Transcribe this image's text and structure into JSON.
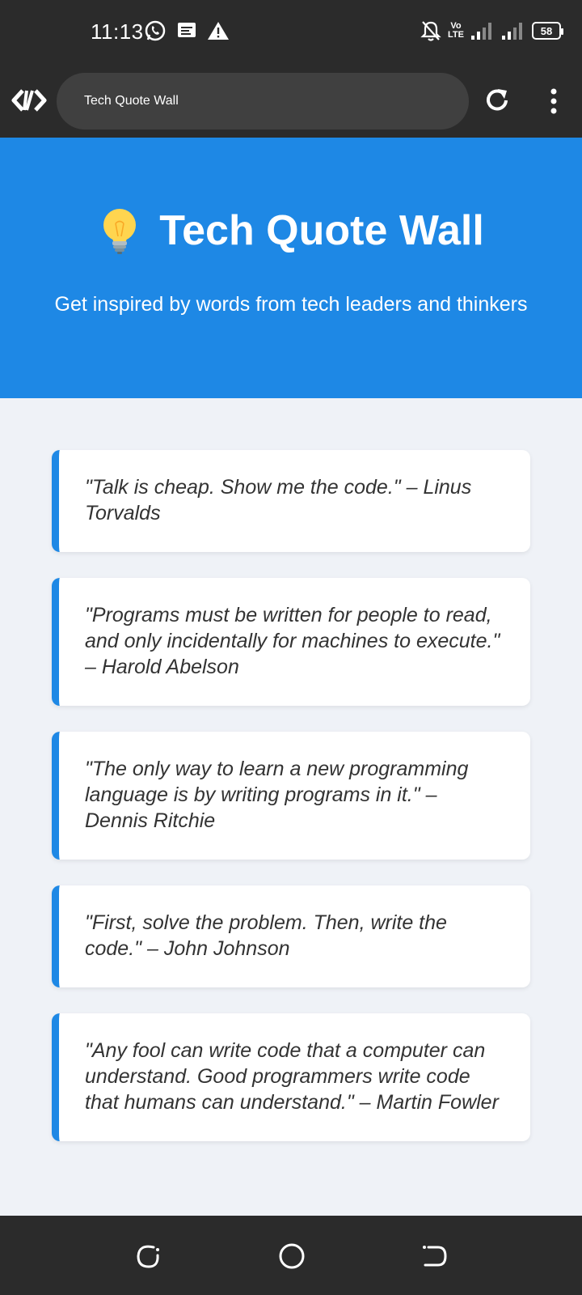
{
  "status_bar": {
    "time": "11:13",
    "battery": "58",
    "network_label": "Vo\nLTE"
  },
  "browser": {
    "url_text": "Tech Quote Wall"
  },
  "hero": {
    "title": "Tech Quote Wall",
    "subtitle": "Get inspired by words from tech leaders and thinkers"
  },
  "quotes": [
    {
      "text": "\"Talk is cheap. Show me the code.\" – Linus Torvalds"
    },
    {
      "text": "\"Programs must be written for people to read, and only incidentally for machines to execute.\" – Harold Abelson"
    },
    {
      "text": "\"The only way to learn a new programming language is by writing programs in it.\" – Dennis Ritchie"
    },
    {
      "text": "\"First, solve the problem. Then, write the code.\" – John Johnson"
    },
    {
      "text": "\"Any fool can write code that a computer can understand. Good programmers write code that humans can understand.\" – Martin Fowler"
    }
  ],
  "colors": {
    "hero_bg": "#1e88e5",
    "page_bg": "#eff2f7",
    "system_bar": "#2b2b2b"
  },
  "icons": [
    "whatsapp-icon",
    "message-icon",
    "warning-icon",
    "mute-icon",
    "signal-icon",
    "battery-icon",
    "browser-logo-icon",
    "reload-icon",
    "more-icon",
    "lightbulb-icon",
    "recent-apps-icon",
    "home-icon",
    "back-icon"
  ]
}
